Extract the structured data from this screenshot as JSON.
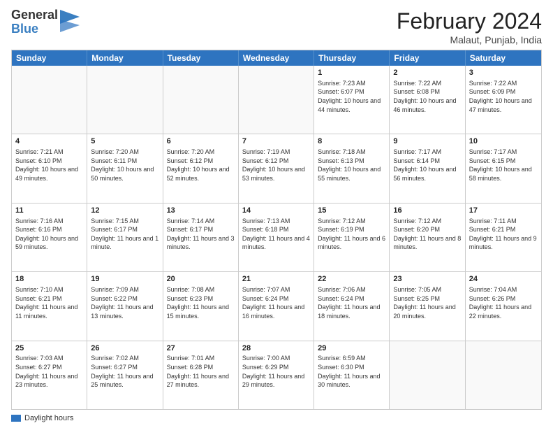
{
  "header": {
    "logo_general": "General",
    "logo_blue": "Blue",
    "month": "February 2024",
    "location": "Malaut, Punjab, India"
  },
  "days_of_week": [
    "Sunday",
    "Monday",
    "Tuesday",
    "Wednesday",
    "Thursday",
    "Friday",
    "Saturday"
  ],
  "footer": {
    "legend_label": "Daylight hours"
  },
  "weeks": [
    [
      {
        "day": "",
        "sunrise": "",
        "sunset": "",
        "daylight": ""
      },
      {
        "day": "",
        "sunrise": "",
        "sunset": "",
        "daylight": ""
      },
      {
        "day": "",
        "sunrise": "",
        "sunset": "",
        "daylight": ""
      },
      {
        "day": "",
        "sunrise": "",
        "sunset": "",
        "daylight": ""
      },
      {
        "day": "1",
        "sunrise": "Sunrise: 7:23 AM",
        "sunset": "Sunset: 6:07 PM",
        "daylight": "Daylight: 10 hours and 44 minutes."
      },
      {
        "day": "2",
        "sunrise": "Sunrise: 7:22 AM",
        "sunset": "Sunset: 6:08 PM",
        "daylight": "Daylight: 10 hours and 46 minutes."
      },
      {
        "day": "3",
        "sunrise": "Sunrise: 7:22 AM",
        "sunset": "Sunset: 6:09 PM",
        "daylight": "Daylight: 10 hours and 47 minutes."
      }
    ],
    [
      {
        "day": "4",
        "sunrise": "Sunrise: 7:21 AM",
        "sunset": "Sunset: 6:10 PM",
        "daylight": "Daylight: 10 hours and 49 minutes."
      },
      {
        "day": "5",
        "sunrise": "Sunrise: 7:20 AM",
        "sunset": "Sunset: 6:11 PM",
        "daylight": "Daylight: 10 hours and 50 minutes."
      },
      {
        "day": "6",
        "sunrise": "Sunrise: 7:20 AM",
        "sunset": "Sunset: 6:12 PM",
        "daylight": "Daylight: 10 hours and 52 minutes."
      },
      {
        "day": "7",
        "sunrise": "Sunrise: 7:19 AM",
        "sunset": "Sunset: 6:12 PM",
        "daylight": "Daylight: 10 hours and 53 minutes."
      },
      {
        "day": "8",
        "sunrise": "Sunrise: 7:18 AM",
        "sunset": "Sunset: 6:13 PM",
        "daylight": "Daylight: 10 hours and 55 minutes."
      },
      {
        "day": "9",
        "sunrise": "Sunrise: 7:17 AM",
        "sunset": "Sunset: 6:14 PM",
        "daylight": "Daylight: 10 hours and 56 minutes."
      },
      {
        "day": "10",
        "sunrise": "Sunrise: 7:17 AM",
        "sunset": "Sunset: 6:15 PM",
        "daylight": "Daylight: 10 hours and 58 minutes."
      }
    ],
    [
      {
        "day": "11",
        "sunrise": "Sunrise: 7:16 AM",
        "sunset": "Sunset: 6:16 PM",
        "daylight": "Daylight: 10 hours and 59 minutes."
      },
      {
        "day": "12",
        "sunrise": "Sunrise: 7:15 AM",
        "sunset": "Sunset: 6:17 PM",
        "daylight": "Daylight: 11 hours and 1 minute."
      },
      {
        "day": "13",
        "sunrise": "Sunrise: 7:14 AM",
        "sunset": "Sunset: 6:17 PM",
        "daylight": "Daylight: 11 hours and 3 minutes."
      },
      {
        "day": "14",
        "sunrise": "Sunrise: 7:13 AM",
        "sunset": "Sunset: 6:18 PM",
        "daylight": "Daylight: 11 hours and 4 minutes."
      },
      {
        "day": "15",
        "sunrise": "Sunrise: 7:12 AM",
        "sunset": "Sunset: 6:19 PM",
        "daylight": "Daylight: 11 hours and 6 minutes."
      },
      {
        "day": "16",
        "sunrise": "Sunrise: 7:12 AM",
        "sunset": "Sunset: 6:20 PM",
        "daylight": "Daylight: 11 hours and 8 minutes."
      },
      {
        "day": "17",
        "sunrise": "Sunrise: 7:11 AM",
        "sunset": "Sunset: 6:21 PM",
        "daylight": "Daylight: 11 hours and 9 minutes."
      }
    ],
    [
      {
        "day": "18",
        "sunrise": "Sunrise: 7:10 AM",
        "sunset": "Sunset: 6:21 PM",
        "daylight": "Daylight: 11 hours and 11 minutes."
      },
      {
        "day": "19",
        "sunrise": "Sunrise: 7:09 AM",
        "sunset": "Sunset: 6:22 PM",
        "daylight": "Daylight: 11 hours and 13 minutes."
      },
      {
        "day": "20",
        "sunrise": "Sunrise: 7:08 AM",
        "sunset": "Sunset: 6:23 PM",
        "daylight": "Daylight: 11 hours and 15 minutes."
      },
      {
        "day": "21",
        "sunrise": "Sunrise: 7:07 AM",
        "sunset": "Sunset: 6:24 PM",
        "daylight": "Daylight: 11 hours and 16 minutes."
      },
      {
        "day": "22",
        "sunrise": "Sunrise: 7:06 AM",
        "sunset": "Sunset: 6:24 PM",
        "daylight": "Daylight: 11 hours and 18 minutes."
      },
      {
        "day": "23",
        "sunrise": "Sunrise: 7:05 AM",
        "sunset": "Sunset: 6:25 PM",
        "daylight": "Daylight: 11 hours and 20 minutes."
      },
      {
        "day": "24",
        "sunrise": "Sunrise: 7:04 AM",
        "sunset": "Sunset: 6:26 PM",
        "daylight": "Daylight: 11 hours and 22 minutes."
      }
    ],
    [
      {
        "day": "25",
        "sunrise": "Sunrise: 7:03 AM",
        "sunset": "Sunset: 6:27 PM",
        "daylight": "Daylight: 11 hours and 23 minutes."
      },
      {
        "day": "26",
        "sunrise": "Sunrise: 7:02 AM",
        "sunset": "Sunset: 6:27 PM",
        "daylight": "Daylight: 11 hours and 25 minutes."
      },
      {
        "day": "27",
        "sunrise": "Sunrise: 7:01 AM",
        "sunset": "Sunset: 6:28 PM",
        "daylight": "Daylight: 11 hours and 27 minutes."
      },
      {
        "day": "28",
        "sunrise": "Sunrise: 7:00 AM",
        "sunset": "Sunset: 6:29 PM",
        "daylight": "Daylight: 11 hours and 29 minutes."
      },
      {
        "day": "29",
        "sunrise": "Sunrise: 6:59 AM",
        "sunset": "Sunset: 6:30 PM",
        "daylight": "Daylight: 11 hours and 30 minutes."
      },
      {
        "day": "",
        "sunrise": "",
        "sunset": "",
        "daylight": ""
      },
      {
        "day": "",
        "sunrise": "",
        "sunset": "",
        "daylight": ""
      }
    ]
  ]
}
